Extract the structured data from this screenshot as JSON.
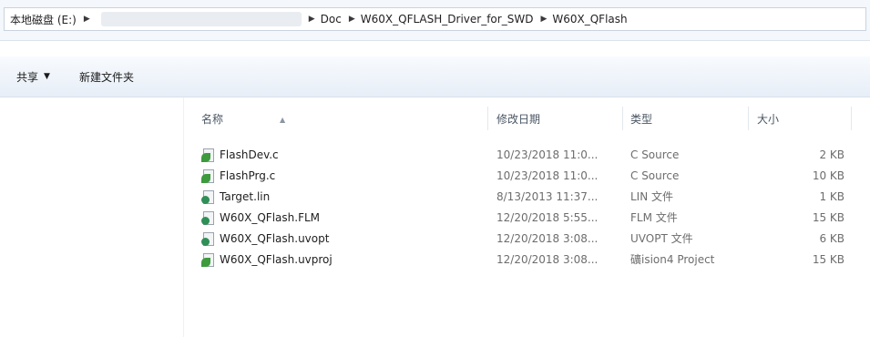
{
  "address_bar": {
    "crumbs": [
      "本地磁盘 (E:)",
      "Doc",
      "W60X_QFLASH_Driver_for_SWD",
      "W60X_QFlash"
    ]
  },
  "toolbar": {
    "share_label": "共享",
    "new_folder_label": "新建文件夹"
  },
  "columns": {
    "name": "名称",
    "date": "修改日期",
    "type": "类型",
    "size": "大小"
  },
  "files": [
    {
      "name": "FlashDev.c",
      "date": "10/23/2018 11:0...",
      "type": "C Source",
      "size": "2 KB",
      "icon": "c-source-file-icon"
    },
    {
      "name": "FlashPrg.c",
      "date": "10/23/2018 11:0...",
      "type": "C Source",
      "size": "10 KB",
      "icon": "c-source-file-icon"
    },
    {
      "name": "Target.lin",
      "date": "8/13/2013 11:37...",
      "type": "LIN 文件",
      "size": "1 KB",
      "icon": "generic-file-icon"
    },
    {
      "name": "W60X_QFlash.FLM",
      "date": "12/20/2018 5:55...",
      "type": "FLM 文件",
      "size": "15 KB",
      "icon": "generic-file-icon"
    },
    {
      "name": "W60X_QFlash.uvopt",
      "date": "12/20/2018 3:08...",
      "type": "UVOPT 文件",
      "size": "6 KB",
      "icon": "generic-file-icon"
    },
    {
      "name": "W60X_QFlash.uvproj",
      "date": "12/20/2018 3:08...",
      "type": "礦ision4 Project",
      "size": "15 KB",
      "icon": "uvision-project-icon"
    }
  ]
}
